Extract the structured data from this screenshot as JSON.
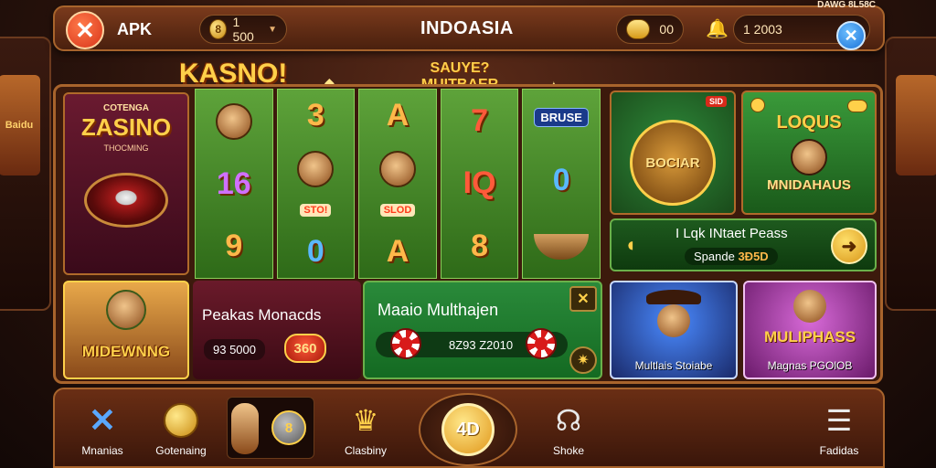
{
  "topbar": {
    "apk_label": "APK",
    "balance": "1 500",
    "balance_coin_glyph": "8",
    "region_title": "INDOASIA",
    "gems_value": "00",
    "search_value": "1 2003",
    "corner_text": "DAWG 8L58C"
  },
  "banners": {
    "kasno": "KASNO!",
    "sauvye_line1": "SAUYE?",
    "sauvye_line2": "MUITBAER"
  },
  "side_machines": {
    "left_screen": "Baidu",
    "right_screen": ""
  },
  "promo_zasino": {
    "small": "COTENGA",
    "big": "ZASINO",
    "sub": "THOCMING"
  },
  "reels": [
    [
      "",
      "16",
      "9"
    ],
    [
      "3",
      "STO",
      "0"
    ],
    [
      "A",
      "SLOD",
      "A"
    ],
    [
      "7",
      "IQ",
      "8"
    ],
    [
      "BRUSE",
      "0",
      ""
    ]
  ],
  "reel_badges": {
    "stop": "STO!",
    "slod": "SLOD"
  },
  "promo_bocar": {
    "tag": "SID",
    "title": "BOCIAR"
  },
  "promo_lorus": {
    "title": "LOQUS",
    "sub": "MNIDAHAUS"
  },
  "ticker": {
    "title": "I Lqk INtaet Peass",
    "sub_label": "Spande",
    "sub_value": "3Đ5D"
  },
  "promo_mining": {
    "title": "MIDEWNNG"
  },
  "panel_peakas": {
    "title": "Peakas Monacds",
    "value": "93 5000",
    "badge": "360"
  },
  "panel_mario": {
    "title": "Maaio Multhajen",
    "value": "8Z93 Z2010"
  },
  "card_cowboy": {
    "label": "Multlais Stoiabe"
  },
  "card_multi": {
    "title": "MULIPHASS",
    "label": "Magnas PGOlOB"
  },
  "bottom_nav": {
    "items": [
      {
        "label": "Mnanias"
      },
      {
        "label": "Gotenaing"
      },
      {
        "label": ""
      },
      {
        "label": "Clasbiny"
      },
      {
        "label": "4D"
      },
      {
        "label": "Shoke"
      },
      {
        "label": "Fadidas"
      }
    ],
    "feature_coin": "8"
  },
  "colors": {
    "accent_gold": "#ffd04a",
    "frame_brown": "#a8642c",
    "reel_green": "#5ea33a"
  }
}
